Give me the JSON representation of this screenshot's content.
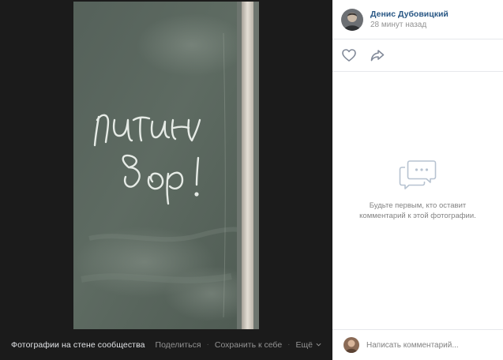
{
  "viewer": {
    "album_title": "Фотографии на стене сообщества",
    "share_label": "Поделиться",
    "save_label": "Сохранить к себе",
    "more_label": "Ещё",
    "separator": "·"
  },
  "photo": {
    "handwriting_line1": "путин",
    "handwriting_line2": "вор!"
  },
  "author": {
    "name": "Денис Дубовицкий",
    "time": "28 минут назад"
  },
  "actions": {
    "like_icon": "heart-icon",
    "share_icon": "share-arrow-icon"
  },
  "comments": {
    "empty_line1": "Будьте первым, кто оставит",
    "empty_line2": "комментарий к этой фотографии.",
    "input_placeholder": "Написать комментарий..."
  },
  "colors": {
    "viewer_bg": "#1b1b1b",
    "link_blue": "#2a5885",
    "muted_text": "#939393",
    "chalkboard": "#5c6a60"
  }
}
